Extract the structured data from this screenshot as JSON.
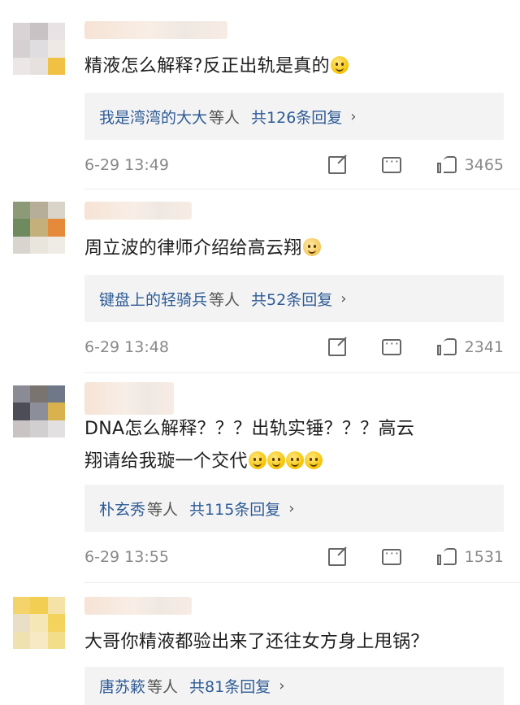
{
  "comments": [
    {
      "text": "精液怎么解释?反正出轨是真的",
      "emojis": 1,
      "reply_names": "我是湾湾的大大",
      "reply_suffix": "等人",
      "reply_total": "共126条回复",
      "time": "6-29 13:49",
      "likes": "3465",
      "avatar_colors": [
        "#d8d4d6",
        "#c9c2c5",
        "#e8e2e4",
        "#d6d0d2",
        "#e0dde0",
        "#efe9e4",
        "#ebe7e7",
        "#e6e1df",
        "#f0c142"
      ]
    },
    {
      "text": "周立波的律师介绍给高云翔",
      "emojis": 1,
      "reply_names": "键盘上的轻骑兵",
      "reply_suffix": "等人",
      "reply_total": "共52条回复",
      "time": "6-29 13:48",
      "likes": "2341",
      "avatar_colors": [
        "#8d9a78",
        "#b7ae9a",
        "#d8d4c8",
        "#6f8a5f",
        "#c4b07a",
        "#e48a3a",
        "#d7d5ce",
        "#e9e4dc",
        "#efece6"
      ]
    },
    {
      "text_line1": "DNA怎么解释？？？出轨实锤？？？高云",
      "text_line2": "翔请给我璇一个交代",
      "emojis": 4,
      "reply_names": "朴玄秀",
      "reply_suffix": "等人",
      "reply_total": "共115条回复",
      "time": "6-29 13:55",
      "likes": "1531",
      "avatar_colors": [
        "#8a8b94",
        "#7a7470",
        "#6f7888",
        "#4d4d57",
        "#8c8f9a",
        "#d9b14d",
        "#c9c3c4",
        "#d1cfd0",
        "#e3e0e1"
      ]
    },
    {
      "text": "大哥你精液都验出来了还往女方身上甩锅？",
      "reply_names": "唐苏簌",
      "reply_suffix": "等人",
      "reply_total": "共81条回复",
      "avatar_colors": [
        "#f4d36a",
        "#f2cf53",
        "#f4e2a6",
        "#e9dfc7",
        "#f6e7b7",
        "#f3d35c",
        "#efe2b0",
        "#f6e9c4",
        "#f2dd8a"
      ]
    }
  ],
  "icons": {
    "forward": "forward-icon",
    "comment": "comment-icon",
    "like": "like-icon"
  },
  "colors": {
    "link": "#2e5b96",
    "meta": "#888888",
    "reply_bg": "#f3f3f3"
  }
}
